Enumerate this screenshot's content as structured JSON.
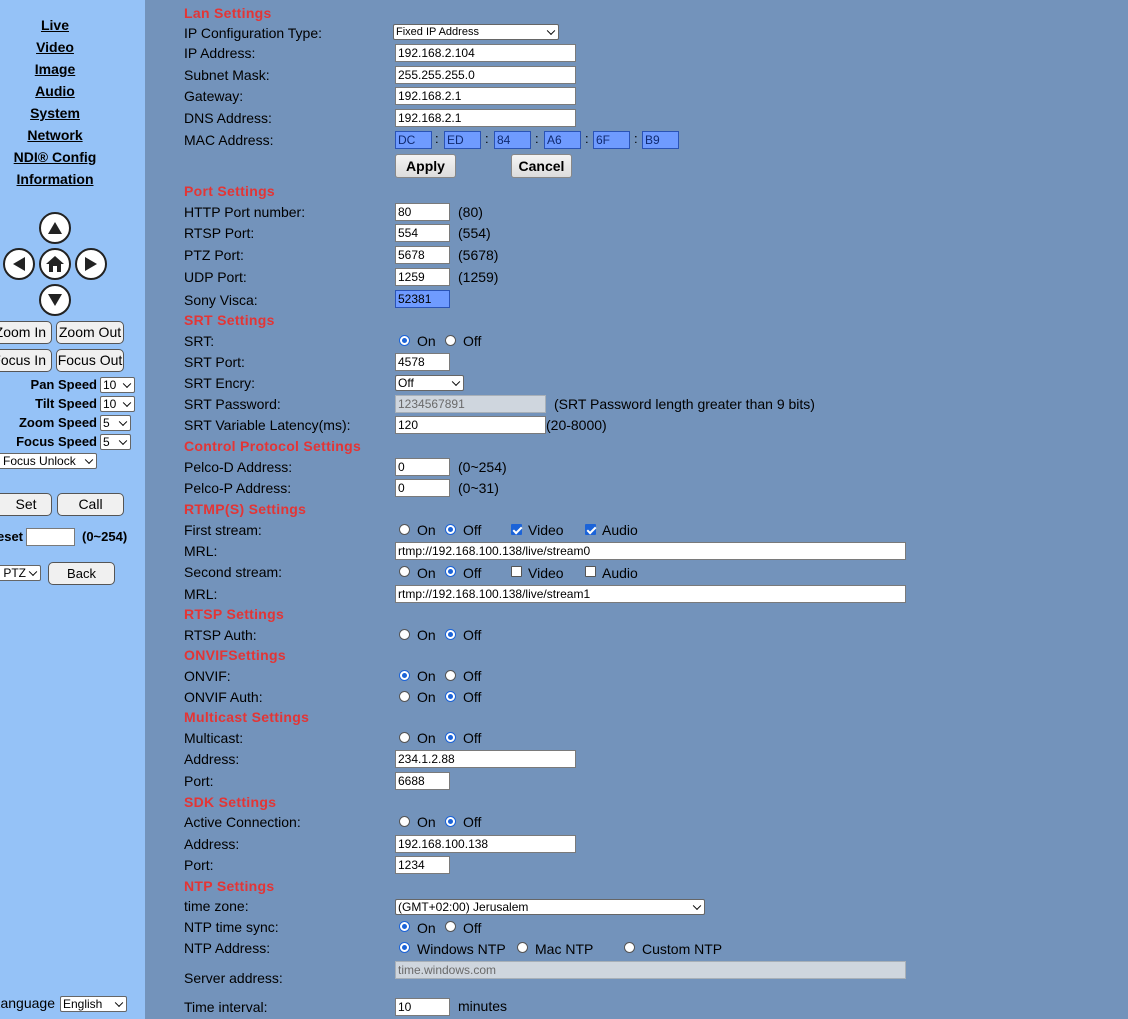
{
  "nav": {
    "live": "Live",
    "video": "Video",
    "image": "Image",
    "audio": "Audio",
    "system": "System",
    "network": "Network",
    "ndi": "NDI® Config",
    "information": "Information"
  },
  "ptz": {
    "zoom_in": "Zoom In",
    "zoom_out": "Zoom Out",
    "focus_in": "Focus In",
    "focus_out": "Focus Out",
    "pan_speed_label": "Pan Speed",
    "pan_speed": "10",
    "tilt_speed_label": "Tilt Speed",
    "tilt_speed": "10",
    "zoom_speed_label": "Zoom Speed",
    "zoom_speed": "5",
    "focus_speed_label": "Focus Speed",
    "focus_speed": "5",
    "focus_mode": "Auto Focus Unlock",
    "set": "Set",
    "call": "Call",
    "preset_label": "Preset",
    "preset_value": "",
    "preset_range": "(0~254)",
    "mode": "PTZ",
    "back": "Back",
    "language_label": "Language",
    "language": "English"
  },
  "lan": {
    "title": "Lan Settings",
    "ip_config_label": "IP Configuration Type:",
    "ip_config": "Fixed IP Address",
    "ip_label": "IP Address:",
    "ip": "192.168.2.104",
    "subnet_label": "Subnet Mask:",
    "subnet": "255.255.255.0",
    "gateway_label": "Gateway:",
    "gateway": "192.168.2.1",
    "dns_label": "DNS Address:",
    "dns": "192.168.2.1",
    "mac_label": "MAC Address:",
    "mac": [
      "DC",
      "ED",
      "84",
      "A6",
      "6F",
      "B9"
    ],
    "apply": "Apply",
    "cancel": "Cancel"
  },
  "port": {
    "title": "Port Settings",
    "http_label": "HTTP Port number:",
    "http": "80",
    "http_default": "(80)",
    "rtsp_label": "RTSP Port:",
    "rtsp": "554",
    "rtsp_default": "(554)",
    "ptz_label": "PTZ Port:",
    "ptz": "5678",
    "ptz_default": "(5678)",
    "udp_label": "UDP Port:",
    "udp": "1259",
    "udp_default": "(1259)",
    "visca_label": "Sony Visca:",
    "visca": "52381"
  },
  "srt": {
    "title": "SRT Settings",
    "srt_label": "SRT:",
    "on": "On",
    "off": "Off",
    "srt_state": "On",
    "port_label": "SRT Port:",
    "port": "4578",
    "encry_label": "SRT Encry:",
    "encry": "Off",
    "password_label": "SRT Password:",
    "password": "1234567891",
    "password_hint": "(SRT Password length greater than 9 bits)",
    "latency_label": "SRT Variable Latency(ms):",
    "latency": "120",
    "latency_hint": "(20-8000)"
  },
  "control": {
    "title": "Control Protocol Settings",
    "pelco_d_label": "Pelco-D Address:",
    "pelco_d": "0",
    "pelco_d_hint": "(0~254)",
    "pelco_p_label": "Pelco-P Address:",
    "pelco_p": "0",
    "pelco_p_hint": "(0~31)"
  },
  "rtmp": {
    "title": "RTMP(S) Settings",
    "first_label": "First stream:",
    "first_state": "Off",
    "video": "Video",
    "audio": "Audio",
    "mrl_label": "MRL:",
    "mrl1": "rtmp://192.168.100.138/live/stream0",
    "second_label": "Second stream:",
    "second_state": "Off",
    "mrl2": "rtmp://192.168.100.138/live/stream1"
  },
  "rtsp": {
    "title": "RTSP Settings",
    "auth_label": "RTSP Auth:",
    "auth_state": "Off"
  },
  "onvif": {
    "title": "ONVIFSettings",
    "onvif_label": "ONVIF:",
    "onvif_state": "On",
    "auth_label": "ONVIF Auth:",
    "auth_state": "Off"
  },
  "multicast": {
    "title": "Multicast Settings",
    "label": "Multicast:",
    "state": "Off",
    "address_label": "Address:",
    "address": "234.1.2.88",
    "port_label": "Port:",
    "port": "6688"
  },
  "sdk": {
    "title": "SDK Settings",
    "active_label": "Active Connection:",
    "state": "Off",
    "address_label": "Address:",
    "address": "192.168.100.138",
    "port_label": "Port:",
    "port": "1234"
  },
  "ntp": {
    "title": "NTP Settings",
    "tz_label": "time zone:",
    "tz": "(GMT+02:00) Jerusalem",
    "sync_label": "NTP time sync:",
    "sync_state": "On",
    "address_label": "NTP Address:",
    "windows": "Windows NTP",
    "mac": "Mac NTP",
    "custom": "Custom NTP",
    "server_label": "Server address:",
    "server": "time.windows.com",
    "interval_label": "Time interval:",
    "interval": "10",
    "interval_unit": "minutes"
  },
  "colors": {
    "sidebar": "#95c2f7",
    "main": "#7393bb",
    "section": "#e33535",
    "accent": "#1b63d8"
  }
}
